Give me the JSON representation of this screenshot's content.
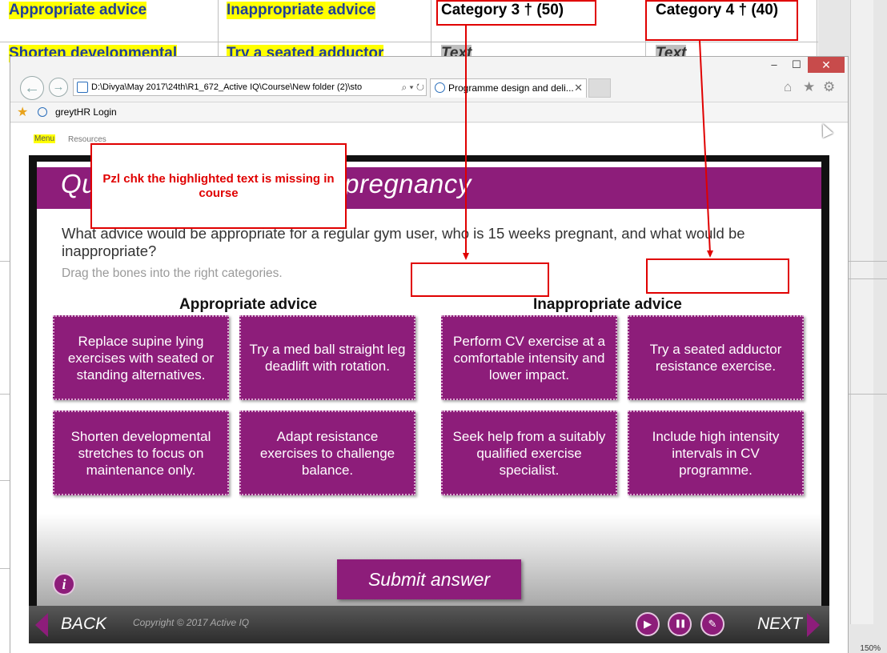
{
  "document": {
    "headers": [
      "Appropriate advice",
      "Inappropriate advice",
      "Category 3 † (50)",
      "Category 4 † (40)"
    ],
    "row2": [
      "Shorten developmental",
      "Try a seated adductor",
      "Text",
      "Text"
    ],
    "zoom": "150%"
  },
  "browser": {
    "window_controls": {
      "minimize": "–",
      "maximize": "☐",
      "close": "✕"
    },
    "nav": {
      "back": "←",
      "forward": "→"
    },
    "address": "D:\\Divya\\May 2017\\24th\\R1_672_Active IQ\\Course\\New folder (2)\\sto",
    "address_tools": "⌕ ▾ ↻",
    "tab_title": "Programme design and deli...",
    "tab_close": "✕",
    "toolbar_icons": {
      "home": "⌂",
      "star": "★",
      "gear": "⚙"
    },
    "favorites": {
      "star": "★",
      "link": "greytHR Login"
    }
  },
  "player": {
    "menu": "Menu",
    "resources": "Resources",
    "banner_title": "Quiz: safe activities for pregnancy",
    "question": "What advice would be appropriate for a regular gym user, who is 15 weeks pregnant, and what would be inappropriate?",
    "instruction": "Drag the bones into the right categories.",
    "categories": [
      "Appropriate advice",
      "Inappropriate advice"
    ],
    "bones": [
      "Replace supine lying exercises with seated or standing alternatives.",
      "Try a med ball straight leg deadlift with rotation.",
      "Perform CV exercise at a comfortable intensity and lower impact.",
      "Try a seated adductor resistance exercise.",
      "Shorten developmental stretches to focus on maintenance only.",
      "Adapt resistance exercises to challenge balance.",
      "Seek help from a suitably qualified exercise specialist.",
      "Include high intensity intervals in CV programme."
    ],
    "submit": "Submit answer",
    "info": "i",
    "back": "BACK",
    "next": "NEXT",
    "copyright": "Copyright © 2017 Active IQ",
    "controls": {
      "play": "▶",
      "pause": "❚❚",
      "notes": "✎"
    }
  },
  "annotation": {
    "callout": "Pzl chk the highlighted text is missing in course"
  },
  "colors": {
    "brand_purple": "#8d1d7a",
    "highlight_yellow": "#ffff00",
    "annotation_red": "#e00000"
  }
}
